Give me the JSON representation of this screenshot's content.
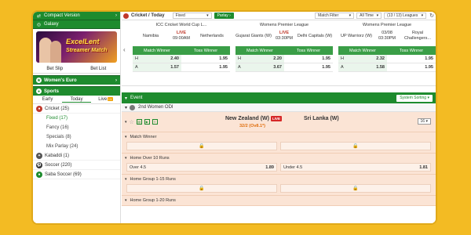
{
  "sidebar": {
    "compact_label": "Compact Version",
    "galaxy_label": "Galaxy",
    "banner": {
      "line1": "ExcelLent",
      "line2": "Streamer Match"
    },
    "bet_slip": "Bet Slip",
    "bet_list": "Bet List",
    "womens_euro": "Women's Euro",
    "sports": "Sports",
    "tabs": [
      "Early",
      "Today",
      "Live"
    ],
    "live_badge": "LV",
    "cricket": "Cricket (25)",
    "cricket_subs": [
      "Fixed (17)",
      "Fancy (16)",
      "Specials (8)",
      "Mix Parlay (24)"
    ],
    "kabaddi": "Kabaddi (1)",
    "soccer": "Soccer (220)",
    "saba_soccer": "Saba Soccer (69)"
  },
  "topbar": {
    "title": "Cricket / Today",
    "fixed": "Fixed",
    "parlay": "Parlay",
    "match_filter": "Match Filter",
    "all_time": "All Time",
    "leagues": "(13 / 13) Leagues"
  },
  "cards": [
    {
      "league": "ICC Cricket World Cup L...",
      "home": "Namibia",
      "live": "LIVE",
      "time": "09:00AM",
      "away": "Netherlands",
      "m1": "Match Winner",
      "m2": "Toss Winner",
      "rows": [
        {
          "l": "H",
          "v1": "2.40",
          "v2": "1.95"
        },
        {
          "l": "A",
          "v1": "1.57",
          "v2": "1.95"
        }
      ]
    },
    {
      "league": "Womens Premier League",
      "home": "Gujarat Giants (W)",
      "live": "LIVE",
      "time": "03:30PM",
      "away": "Delhi Capitals (W)",
      "m1": "Match Winner",
      "m2": "Toss Winner",
      "rows": [
        {
          "l": "H",
          "v1": "2.20",
          "v2": "1.95"
        },
        {
          "l": "A",
          "v1": "3.67",
          "v2": "1.95"
        }
      ]
    },
    {
      "league": "Womens Premier League",
      "home": "UP Warriorz (W)",
      "live": "03/08",
      "time": "03:30PM",
      "away": "Royal Challengers...",
      "m1": "Match Winner",
      "m2": "Toss Winner",
      "rows": [
        {
          "l": "H",
          "v1": "2.32",
          "v2": "1.95"
        },
        {
          "l": "A",
          "v1": "1.58",
          "v2": "1.95"
        }
      ]
    }
  ],
  "event_bar": {
    "label": "Event",
    "sort": "System Sorting"
  },
  "group": "2nd Women ODI",
  "match": {
    "home": "New Zealand (W)",
    "away": "Sri Lanka (W)",
    "score": "32/2 (Ov8.1*)",
    "live": "LIVE",
    "count": "16"
  },
  "markets": [
    {
      "name": "Match Winner",
      "type": "locked"
    },
    {
      "name": "Home Over 10 Runs",
      "type": "ou",
      "left_label": "Over  4.5",
      "left_val": "1.89",
      "right_label": "Under  4.5",
      "right_val": "1.81"
    },
    {
      "name": "Home Group 1-15 Runs",
      "type": "locked"
    },
    {
      "name": "Home Group 1-20 Runs",
      "type": "header"
    }
  ],
  "colors": {
    "accent": "#1e8b2e",
    "background": "#f3bb23",
    "match_bg": "#fbe4d5",
    "live": "#d62828"
  }
}
